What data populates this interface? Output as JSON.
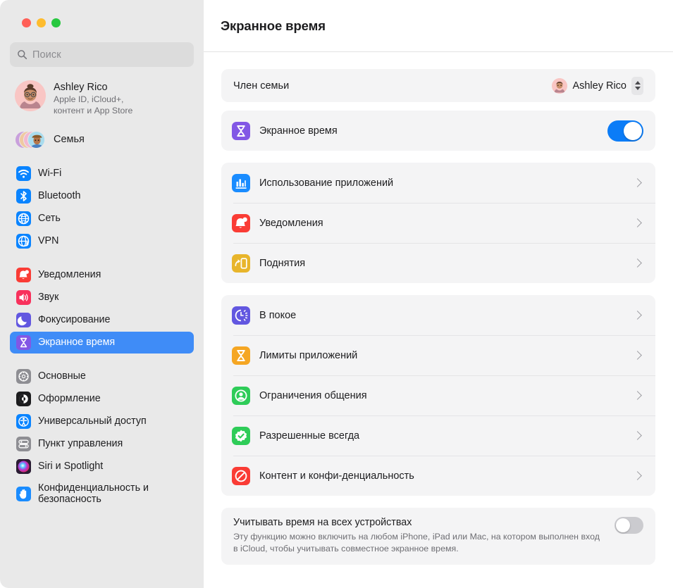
{
  "window": {
    "traffic_lights": [
      "close",
      "minimize",
      "zoom"
    ]
  },
  "sidebar": {
    "search": {
      "placeholder": "Поиск",
      "value": "",
      "icon": "search-icon"
    },
    "account": {
      "name": "Ashley Rico",
      "subtitle": "Apple ID, iCloud+,\nконтент и App Store",
      "subtitle_line1": "Apple ID, iCloud+,",
      "subtitle_line2": "контент и App Store",
      "avatar": "memoji-avatar"
    },
    "family": {
      "label": "Семья",
      "icon": "family-avatars-icon"
    },
    "groups": [
      {
        "items": [
          {
            "label": "Wi-Fi",
            "icon": "wifi-icon",
            "color": "#0a84ff",
            "selected": false
          },
          {
            "label": "Bluetooth",
            "icon": "bluetooth-icon",
            "color": "#0a84ff",
            "selected": false
          },
          {
            "label": "Сеть",
            "icon": "globe-icon",
            "color": "#0a84ff",
            "selected": false
          },
          {
            "label": "VPN",
            "icon": "vpn-globe-icon",
            "color": "#0a84ff",
            "selected": false
          }
        ]
      },
      {
        "items": [
          {
            "label": "Уведомления",
            "icon": "bell-icon",
            "color": "#fa3c35",
            "selected": false
          },
          {
            "label": "Звук",
            "icon": "speaker-icon",
            "color": "#f8315c",
            "selected": false
          },
          {
            "label": "Фокусирование",
            "icon": "moon-icon",
            "color": "#6257e0",
            "selected": false
          },
          {
            "label": "Экранное время",
            "icon": "hourglass-icon",
            "color": "#8257e5",
            "selected": true
          }
        ]
      },
      {
        "items": [
          {
            "label": "Основные",
            "icon": "gear-icon",
            "color": "#8e8e93",
            "selected": false
          },
          {
            "label": "Оформление",
            "icon": "appearance-icon",
            "color": "#1c1c1e",
            "selected": false
          },
          {
            "label": "Универсальный доступ",
            "icon": "accessibility-icon",
            "color": "#0a84ff",
            "selected": false
          },
          {
            "label": "Пункт управления",
            "icon": "control-center-icon",
            "color": "#8e8e93",
            "selected": false
          },
          {
            "label": "Siri и Spotlight",
            "icon": "siri-icon",
            "color": "#3a2a4a",
            "selected": false
          },
          {
            "label": "Конфиденциальность и безопасность",
            "label_line1": "Конфиденциальность и",
            "label_line2": "безопасность",
            "icon": "hand-icon",
            "color": "#1a8cff",
            "selected": false
          }
        ]
      }
    ]
  },
  "header": {
    "title": "Экранное время"
  },
  "main": {
    "member_row": {
      "label": "Член семьи",
      "selected_member": "Ashley Rico",
      "avatar": "memoji-avatar",
      "control": "popup-stepper"
    },
    "screen_time_row": {
      "label": "Экранное время",
      "icon": "hourglass-icon",
      "icon_color": "#8257e5",
      "enabled": true
    },
    "group_usage": [
      {
        "label": "Использование приложений",
        "icon": "chart-bar-icon",
        "icon_color": "#1a8cff"
      },
      {
        "label": "Уведомления",
        "icon": "bell-icon",
        "icon_color": "#fa3c35"
      },
      {
        "label": "Поднятия",
        "icon": "pickups-icon",
        "icon_color": "#e8b52b"
      }
    ],
    "group_limits": [
      {
        "label": "В покое",
        "icon": "downtime-icon",
        "icon_color": "#6257e0"
      },
      {
        "label": "Лимиты приложений",
        "icon": "hourglass-icon",
        "icon_color": "#f5a623"
      },
      {
        "label": "Ограничения общения",
        "icon": "person-circle-icon",
        "icon_color": "#2ecc58"
      },
      {
        "label": "Разрешенные всегда",
        "icon": "always-allowed-icon",
        "icon_color": "#2ecc58"
      },
      {
        "label": "Контент и конфи-денциальность",
        "icon": "restrictions-icon",
        "icon_color": "#fa3c35"
      }
    ],
    "device_row": {
      "title": "Учитывать время на всех устройствах",
      "description": "Эту функцию можно включить на любом iPhone, iPad или Mac, на котором выполнен вход в iCloud, чтобы учитывать совместное экранное время.",
      "enabled": false
    }
  },
  "colors": {
    "accent": "#0b7cf7",
    "selection": "#3f8cf7",
    "sidebar_bg": "#e9e9e9",
    "card_bg": "#f4f4f5"
  }
}
